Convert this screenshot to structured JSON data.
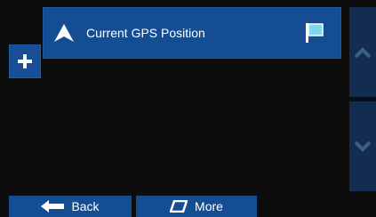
{
  "route": {
    "label": "Current GPS Position",
    "icon": "navigation-arrow-icon",
    "flag_icon": "destination-flag-icon",
    "flag_color": "#7fd7f0"
  },
  "toolbar": {
    "back_label": "Back",
    "more_label": "More"
  },
  "colors": {
    "panel_blue": "#154d92",
    "dark_blue": "#122d4f",
    "background": "#0d0d0d"
  }
}
